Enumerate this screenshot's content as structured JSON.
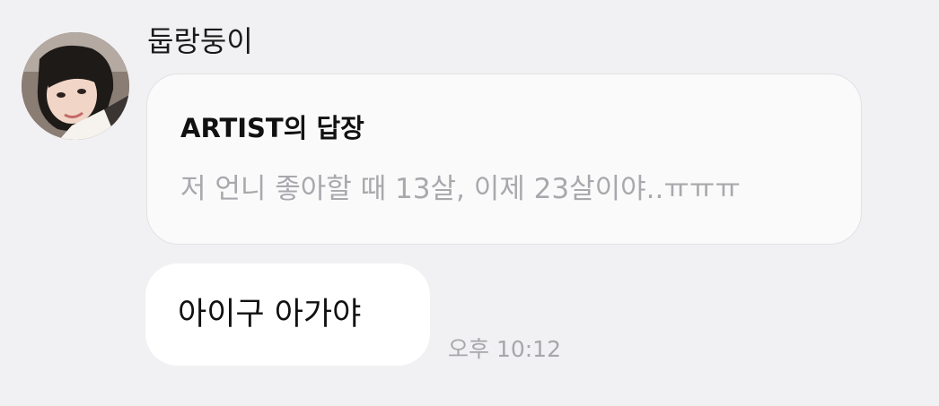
{
  "message": {
    "sender_name": "둡랑둥이",
    "reply": {
      "title": "ARTIST의 답장",
      "quote": "저 언니 좋아할 때 13살, 이제 23살이야..ㅠㅠㅠ"
    },
    "text": "아이구 아가야",
    "timestamp": "오후 10:12"
  },
  "colors": {
    "background": "#f1f1f3",
    "reply_bubble": "#fafafa",
    "message_bubble": "#ffffff",
    "muted_text": "#a8a8ad"
  }
}
